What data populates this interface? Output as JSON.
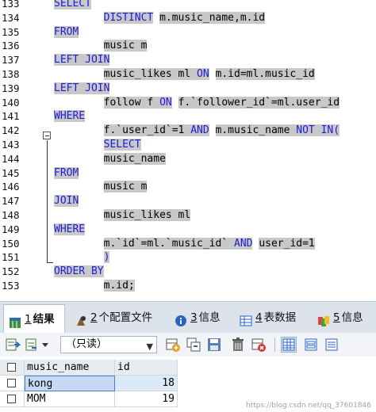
{
  "editor": {
    "lines": [
      {
        "no": "133",
        "tokens": [
          {
            "t": "SELECT",
            "k": true
          }
        ]
      },
      {
        "no": "134",
        "tokens": [
          {
            "t": "        ",
            "k": false
          },
          {
            "t": "DISTINCT",
            "k": true
          },
          {
            "t": " m.music_name,m.id",
            "k": false
          }
        ]
      },
      {
        "no": "135",
        "tokens": [
          {
            "t": "FROM",
            "k": true
          }
        ]
      },
      {
        "no": "136",
        "tokens": [
          {
            "t": "        music m",
            "k": false
          }
        ]
      },
      {
        "no": "137",
        "tokens": [
          {
            "t": "LEFT JOIN",
            "k": true
          }
        ]
      },
      {
        "no": "138",
        "tokens": [
          {
            "t": "        music_likes ml ",
            "k": false
          },
          {
            "t": "ON",
            "k": true
          },
          {
            "t": " m.id=ml.music_id",
            "k": false
          }
        ]
      },
      {
        "no": "139",
        "tokens": [
          {
            "t": "LEFT JOIN",
            "k": true
          }
        ]
      },
      {
        "no": "140",
        "tokens": [
          {
            "t": "        follow f ",
            "k": false
          },
          {
            "t": "ON",
            "k": true
          },
          {
            "t": " f.`follower_id`=ml.user_id",
            "k": false
          }
        ]
      },
      {
        "no": "141",
        "tokens": [
          {
            "t": "WHERE",
            "k": true
          }
        ]
      },
      {
        "no": "142",
        "tokens": [
          {
            "t": "        f.`user_id`=1 ",
            "k": false
          },
          {
            "t": "AND",
            "k": true
          },
          {
            "t": " m.music_name ",
            "k": false
          },
          {
            "t": "NOT IN(",
            "k": true
          }
        ]
      },
      {
        "no": "143",
        "tokens": [
          {
            "t": "        ",
            "k": false
          },
          {
            "t": "SELECT",
            "k": true
          }
        ]
      },
      {
        "no": "144",
        "tokens": [
          {
            "t": "        music_name",
            "k": false
          }
        ]
      },
      {
        "no": "145",
        "tokens": [
          {
            "t": "FROM",
            "k": true
          }
        ]
      },
      {
        "no": "146",
        "tokens": [
          {
            "t": "        music m",
            "k": false
          }
        ]
      },
      {
        "no": "147",
        "tokens": [
          {
            "t": "JOIN",
            "k": true
          }
        ]
      },
      {
        "no": "148",
        "tokens": [
          {
            "t": "        music_likes ml",
            "k": false
          }
        ]
      },
      {
        "no": "149",
        "tokens": [
          {
            "t": "WHERE",
            "k": true
          }
        ]
      },
      {
        "no": "150",
        "tokens": [
          {
            "t": "        m.`id`=ml.`music_id` ",
            "k": false
          },
          {
            "t": "AND",
            "k": true
          },
          {
            "t": " user_id=1",
            "k": false
          }
        ]
      },
      {
        "no": "151",
        "tokens": [
          {
            "t": "        )",
            "k": true
          }
        ]
      },
      {
        "no": "152",
        "tokens": [
          {
            "t": "ORDER BY",
            "k": true
          }
        ]
      },
      {
        "no": "153",
        "tokens": [
          {
            "t": "        m.id;",
            "k": false
          }
        ]
      }
    ]
  },
  "tabs": [
    {
      "num": "1",
      "label": " 结果",
      "icon": "results-icon"
    },
    {
      "num": "2",
      "label": " 个配置文件",
      "icon": "profile-icon"
    },
    {
      "num": "3",
      "label": " 信息",
      "icon": "info-icon"
    },
    {
      "num": "4",
      "label": " 表数据",
      "icon": "table-data-icon"
    },
    {
      "num": "5",
      "label": " 信息",
      "icon": "history-icon"
    }
  ],
  "toolbar": {
    "mode_value": "（只读）"
  },
  "grid": {
    "columns": [
      "music_name",
      "id"
    ],
    "rows": [
      {
        "music_name": "kong",
        "id": "18"
      },
      {
        "music_name": "MOM",
        "id": "19"
      }
    ]
  },
  "watermark": "https://blog.csdn.net/qq_37601846",
  "colors": {
    "keyword": "#1c1cd6",
    "selection": "#c8c8c8",
    "accent": "#4a7fc1"
  }
}
